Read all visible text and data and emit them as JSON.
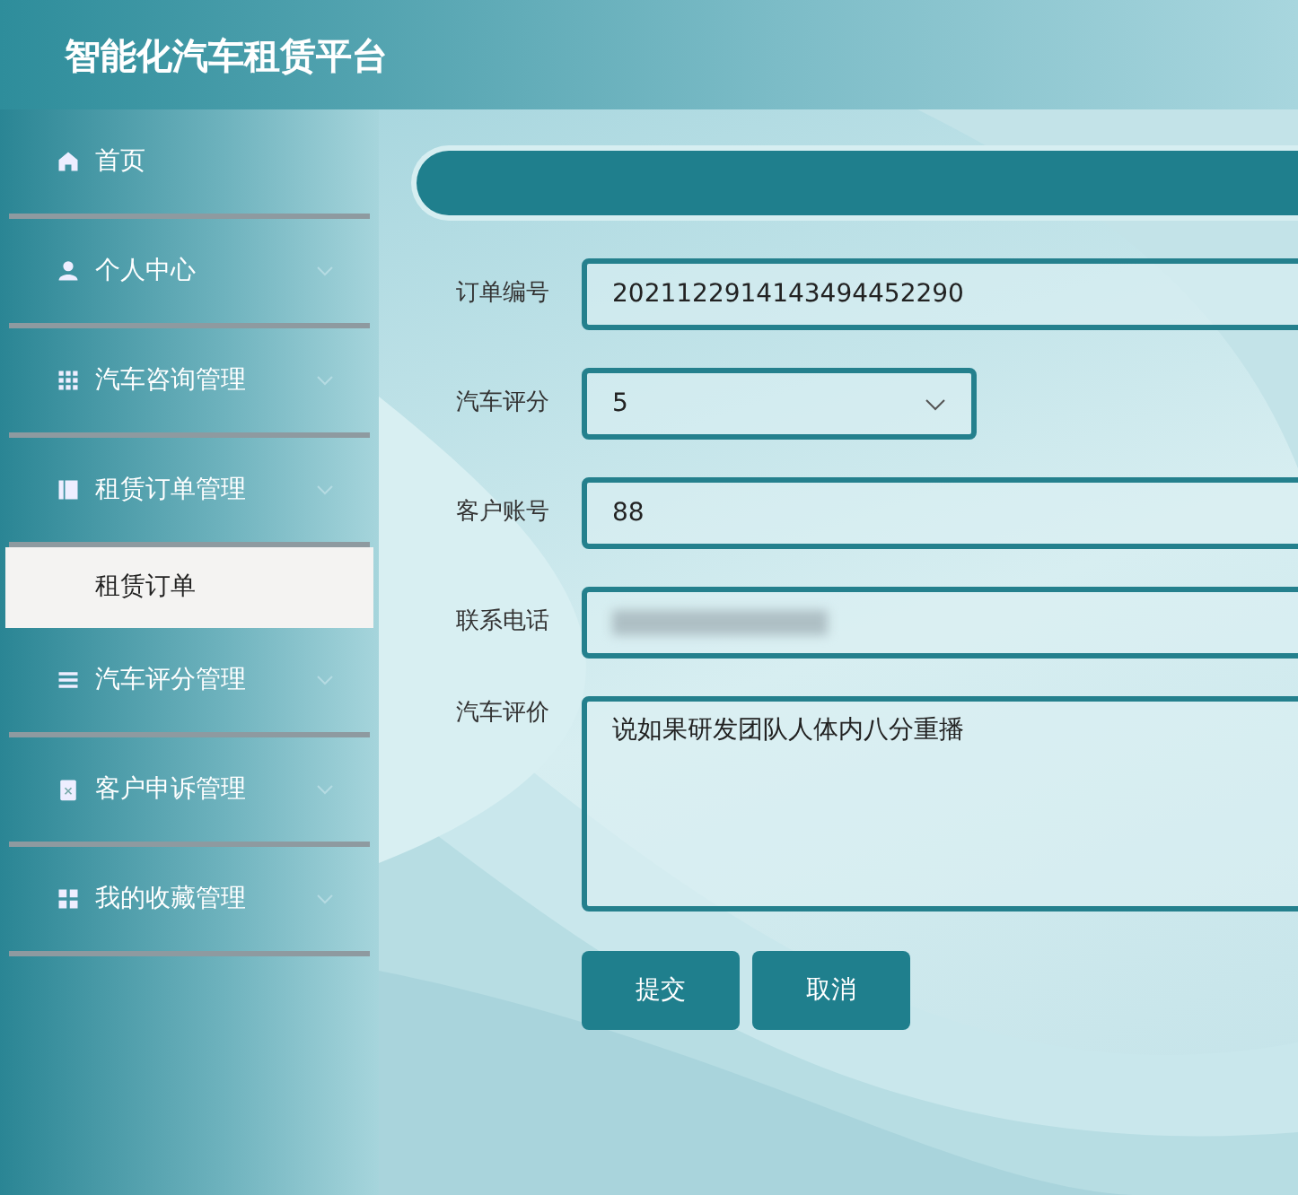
{
  "header": {
    "title": "智能化汽车租赁平台"
  },
  "sidebar": {
    "items": [
      {
        "label": "首页",
        "kind": "link"
      },
      {
        "label": "个人中心",
        "kind": "group"
      },
      {
        "label": "汽车咨询管理",
        "kind": "group"
      },
      {
        "label": "租赁订单管理",
        "kind": "group",
        "children": [
          {
            "label": "租赁订单",
            "selected": true
          }
        ]
      },
      {
        "label": "汽车评分管理",
        "kind": "group"
      },
      {
        "label": "客户申诉管理",
        "kind": "group"
      },
      {
        "label": "我的收藏管理",
        "kind": "group"
      }
    ]
  },
  "form": {
    "fields": [
      {
        "label": "订单编号",
        "kind": "text",
        "value": "2021122914143494452290"
      },
      {
        "label": "汽车评分",
        "kind": "select",
        "value": "5"
      },
      {
        "label": "客户账号",
        "kind": "text",
        "value": "88"
      },
      {
        "label": "联系电话",
        "kind": "redacted"
      },
      {
        "label": "汽车评价",
        "kind": "textarea",
        "value": "说如果研发团队人体内八分重播"
      }
    ],
    "buttons": [
      "提交",
      "取消"
    ]
  }
}
